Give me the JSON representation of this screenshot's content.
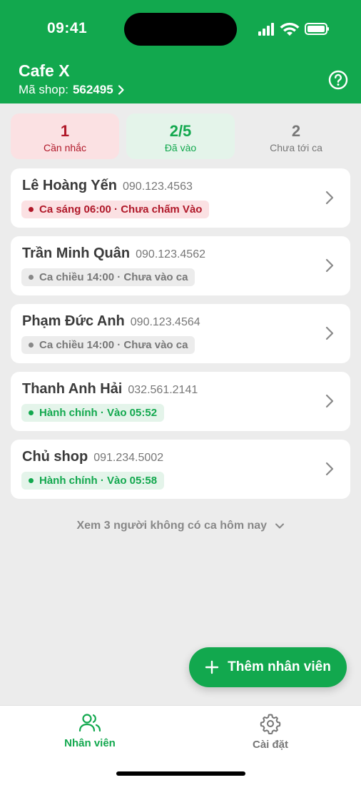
{
  "status_bar": {
    "time": "09:41"
  },
  "header": {
    "shop_name": "Cafe X",
    "shop_code_label": "Mã shop:",
    "shop_code": "562495"
  },
  "summary": [
    {
      "count": "1",
      "label": "Cần nhắc"
    },
    {
      "count": "2/5",
      "label": "Đã vào"
    },
    {
      "count": "2",
      "label": "Chưa tới ca"
    }
  ],
  "employees": [
    {
      "name": "Lê Hoàng Yến",
      "phone": "090.123.4563",
      "status": "Ca sáng 06:00 · Chưa chấm Vào",
      "status_type": "red"
    },
    {
      "name": "Trần Minh Quân",
      "phone": "090.123.4562",
      "status": "Ca chiều 14:00 · Chưa vào ca",
      "status_type": "gray"
    },
    {
      "name": "Phạm Đức Anh",
      "phone": "090.123.4564",
      "status": "Ca chiều 14:00 · Chưa vào ca",
      "status_type": "gray"
    },
    {
      "name": "Thanh Anh Hải",
      "phone": "032.561.2141",
      "status": "Hành chính · Vào 05:52",
      "status_type": "green"
    },
    {
      "name": "Chủ shop",
      "phone": "091.234.5002",
      "status": "Hành chính · Vào 05:58",
      "status_type": "green"
    }
  ],
  "see_more": "Xem 3 người không có ca hôm nay",
  "fab": {
    "label": "Thêm nhân viên"
  },
  "tabbar": {
    "staff_label": "Nhân viên",
    "settings_label": "Cài đặt"
  },
  "colors": {
    "brand_green": "#12a84e",
    "alert_red": "#b01829",
    "background": "#ececec"
  }
}
